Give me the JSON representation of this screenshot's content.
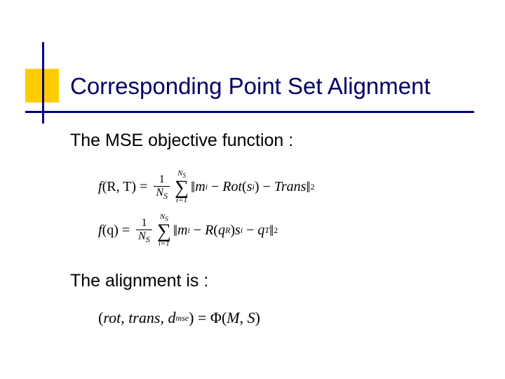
{
  "title": "Corresponding Point Set Alignment",
  "body": {
    "line1": "The MSE objective function :",
    "line2": "The alignment is :"
  },
  "eq1": {
    "lhs_func": "f",
    "lhs_args": "(R, T)",
    "frac_num": "1",
    "frac_den_N": "N",
    "frac_den_sub": "S",
    "sum_upper_N": "N",
    "sum_upper_sub": "S",
    "sum_lower": "i=1",
    "term_m": "m",
    "term_m_sub": "i",
    "rot": "Rot",
    "rot_arg_s": "s",
    "rot_arg_sub": "i",
    "trans": "Trans",
    "exp": "2"
  },
  "eq2": {
    "lhs_func": "f",
    "lhs_args": "(q)",
    "frac_num": "1",
    "frac_den_N": "N",
    "frac_den_sub": "S",
    "sum_upper_N": "N",
    "sum_upper_sub": "S",
    "sum_lower": "i=1",
    "term_m": "m",
    "term_m_sub": "i",
    "R": "R",
    "qR_q": "q",
    "qR_sub": "R",
    "s": "s",
    "s_sub": "i",
    "qT_q": "q",
    "qT_sub": "T",
    "exp": "2"
  },
  "eq3": {
    "rot": "rot",
    "trans": "trans",
    "d": "d",
    "d_sub": "mse",
    "Phi": "Φ",
    "M": "M",
    "S": "S"
  }
}
